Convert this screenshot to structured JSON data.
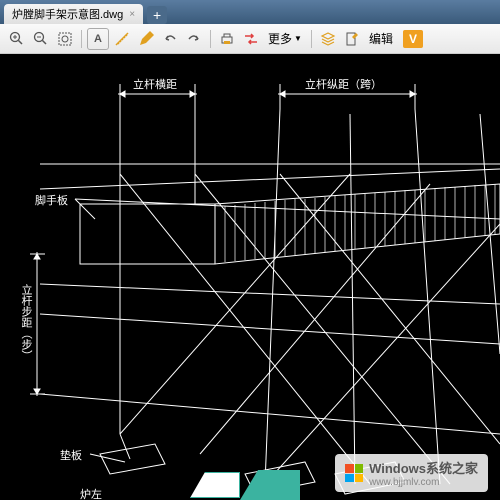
{
  "tab": {
    "title": "炉膛脚手架示意图.dwg",
    "close": "×",
    "add": "+"
  },
  "toolbar": {
    "more": "更多",
    "edit": "编辑",
    "v": "V"
  },
  "drawing": {
    "label_top1": "立杆横距",
    "label_top2": "立杆纵距（跨）",
    "label_board": "脚手板",
    "label_vert": "立杆步距（步）",
    "label_base": "垫板",
    "label_bottom": "炉左"
  },
  "watermark": {
    "text": "Windows系统之家",
    "url": "www.bjjmlv.com"
  }
}
